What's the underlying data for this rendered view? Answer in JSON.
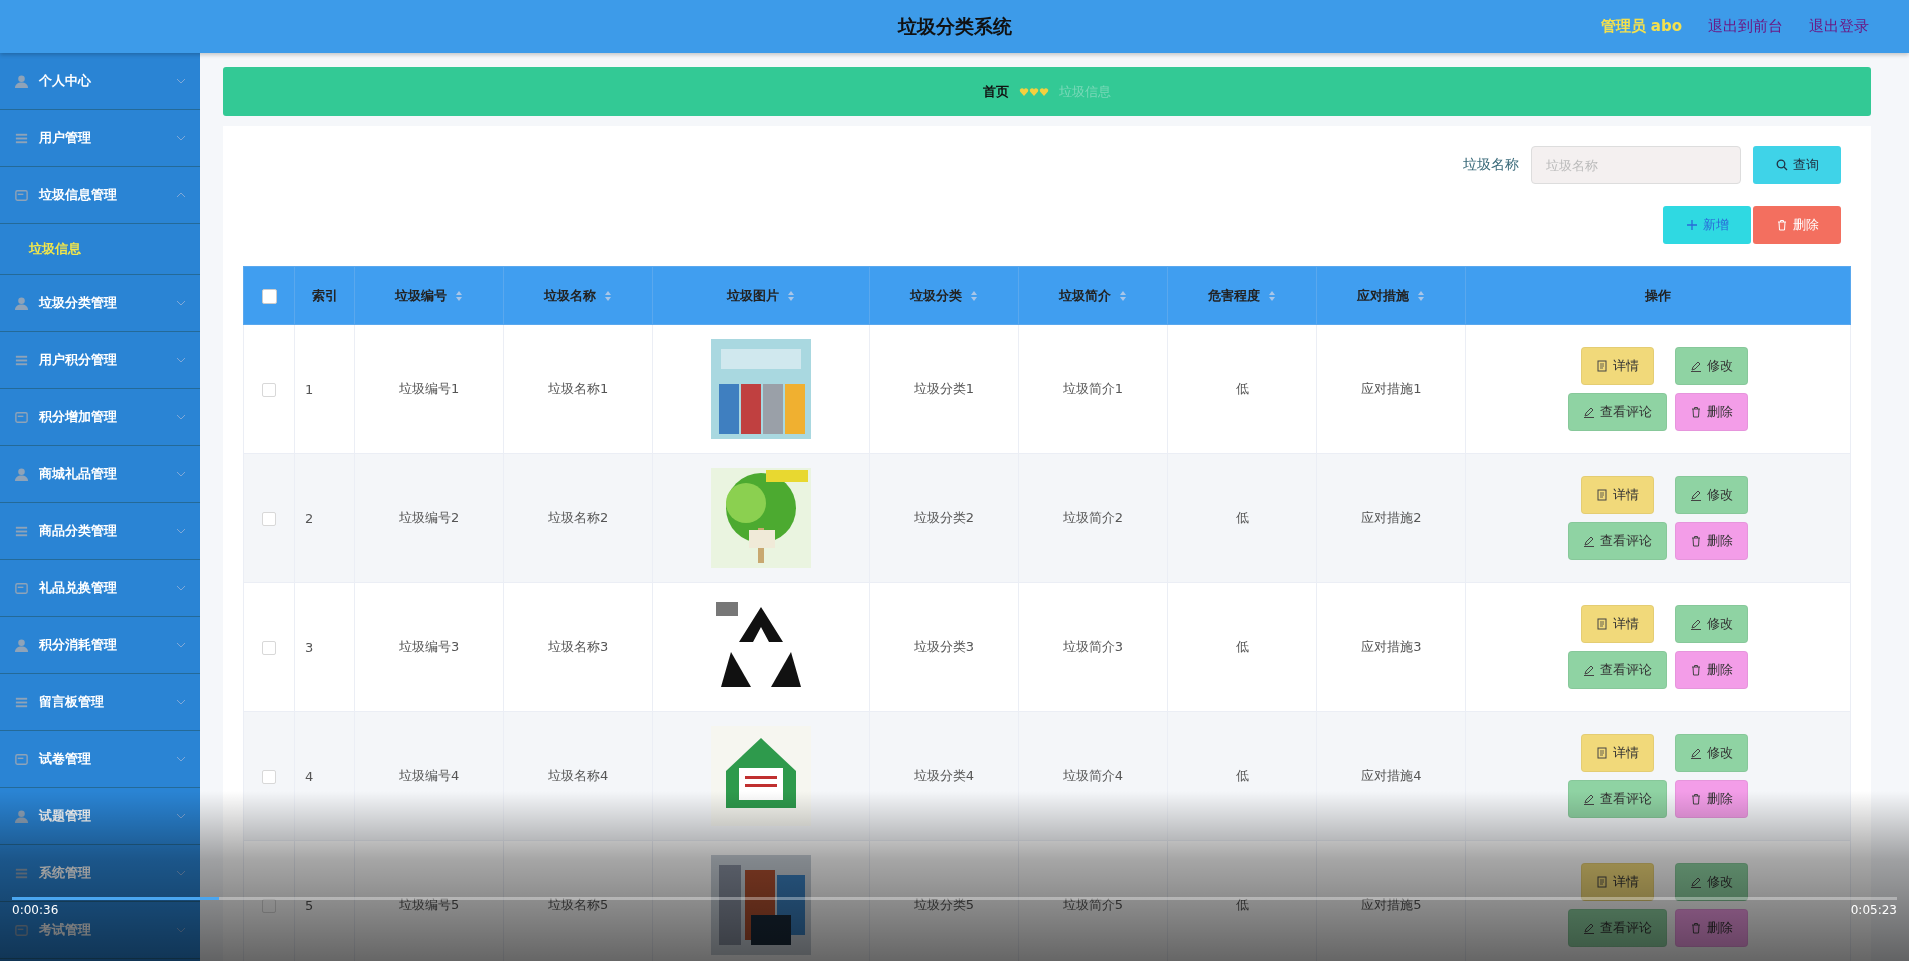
{
  "header": {
    "title": "垃圾分类系统",
    "user": "管理员 abo",
    "links": [
      "退出到前台",
      "退出登录"
    ]
  },
  "sidebar": {
    "items": [
      {
        "label": "个人中心",
        "expanded": false
      },
      {
        "label": "用户管理",
        "expanded": false
      },
      {
        "label": "垃圾信息管理",
        "expanded": true,
        "children": [
          {
            "label": "垃圾信息",
            "selected": true
          }
        ]
      },
      {
        "label": "垃圾分类管理",
        "expanded": false
      },
      {
        "label": "用户积分管理",
        "expanded": false
      },
      {
        "label": "积分增加管理",
        "expanded": false
      },
      {
        "label": "商城礼品管理",
        "expanded": false
      },
      {
        "label": "商品分类管理",
        "expanded": false
      },
      {
        "label": "礼品兑换管理",
        "expanded": false
      },
      {
        "label": "积分消耗管理",
        "expanded": false
      },
      {
        "label": "留言板管理",
        "expanded": false
      },
      {
        "label": "试卷管理",
        "expanded": false
      },
      {
        "label": "试题管理",
        "expanded": false
      },
      {
        "label": "系统管理",
        "expanded": false
      },
      {
        "label": "考试管理",
        "expanded": false
      }
    ]
  },
  "breadcrumb": {
    "home": "首页",
    "current": "垃圾信息"
  },
  "search": {
    "label": "垃圾名称",
    "placeholder": "垃圾名称",
    "button": "查询"
  },
  "toolbar": {
    "add": "新增",
    "delete": "删除"
  },
  "table": {
    "select_all": false,
    "columns": [
      {
        "label": "索引",
        "sortable": false
      },
      {
        "label": "垃圾编号",
        "sortable": true
      },
      {
        "label": "垃圾名称",
        "sortable": true
      },
      {
        "label": "垃圾图片",
        "sortable": true
      },
      {
        "label": "垃圾分类",
        "sortable": true
      },
      {
        "label": "垃圾简介",
        "sortable": true
      },
      {
        "label": "危害程度",
        "sortable": true
      },
      {
        "label": "应对措施",
        "sortable": true
      },
      {
        "label": "操作",
        "sortable": false
      }
    ],
    "rows": [
      {
        "selected": false,
        "index": "1",
        "code": "垃圾编号1",
        "name": "垃圾名称1",
        "image": {
          "kind": "picture"
        },
        "category": "垃圾分类1",
        "intro": "垃圾简介1",
        "hazard": "低",
        "measure": "应对措施1",
        "actions": [
          "详情",
          "修改",
          "查看评论",
          "删除"
        ]
      },
      {
        "selected": false,
        "index": "2",
        "code": "垃圾编号2",
        "name": "垃圾名称2",
        "image": {
          "kind": "picture"
        },
        "category": "垃圾分类2",
        "intro": "垃圾简介2",
        "hazard": "低",
        "measure": "应对措施2",
        "actions": [
          "详情",
          "修改",
          "查看评论",
          "删除"
        ]
      },
      {
        "selected": false,
        "index": "3",
        "code": "垃圾编号3",
        "name": "垃圾名称3",
        "image": {
          "kind": "picture"
        },
        "category": "垃圾分类3",
        "intro": "垃圾简介3",
        "hazard": "低",
        "measure": "应对措施3",
        "actions": [
          "详情",
          "修改",
          "查看评论",
          "删除"
        ]
      },
      {
        "selected": false,
        "index": "4",
        "code": "垃圾编号4",
        "name": "垃圾名称4",
        "image": {
          "kind": "picture"
        },
        "category": "垃圾分类4",
        "intro": "垃圾简介4",
        "hazard": "低",
        "measure": "应对措施4",
        "actions": [
          "详情",
          "修改",
          "查看评论",
          "删除"
        ]
      },
      {
        "selected": false,
        "index": "5",
        "code": "垃圾编号5",
        "name": "垃圾名称5",
        "image": {
          "kind": "picture"
        },
        "category": "垃圾分类5",
        "intro": "垃圾简介5",
        "hazard": "低",
        "measure": "应对措施5",
        "actions": [
          "详情",
          "修改",
          "查看评论",
          "删除"
        ]
      }
    ]
  },
  "player": {
    "elapsed": "0:00:36",
    "duration": "0:05:23",
    "level": 0.11
  }
}
